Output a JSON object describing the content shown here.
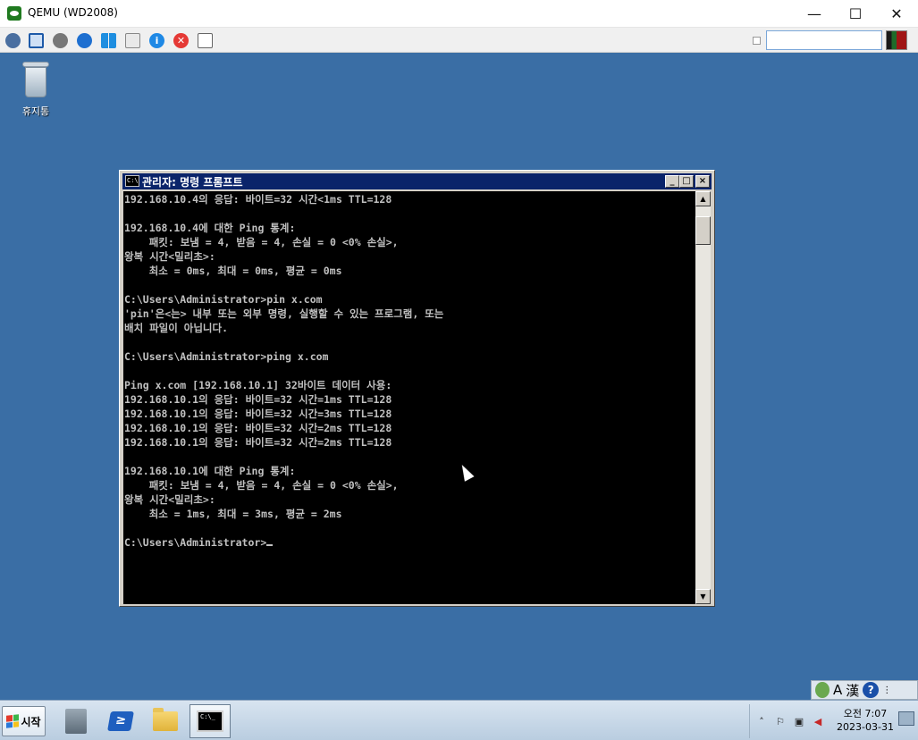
{
  "host": {
    "title": "QEMU (WD2008)",
    "controls": {
      "minimize": "—",
      "maximize": "☐",
      "close": "✕"
    },
    "toolbar_icons": [
      "devices-icon",
      "fullscreen-icon",
      "settings-icon",
      "refresh-icon",
      "windows-icon",
      "usb-icon",
      "info-icon",
      "stop-icon",
      "screenshot-icon"
    ],
    "input_value": ""
  },
  "desktop": {
    "background": "#3a6ea5",
    "recycle_bin_label": "휴지통"
  },
  "cmd": {
    "title": "관리자: 명령 프롬프트",
    "icon_text": "C:\\",
    "buttons": {
      "minimize": "_",
      "maximize": "□",
      "close": "×"
    },
    "lines": [
      "192.168.10.4의 응답: 바이트=32 시간<1ms TTL=128",
      "",
      "192.168.10.4에 대한 Ping 통계:",
      "    패킷: 보냄 = 4, 받음 = 4, 손실 = 0 <0% 손실>,",
      "왕복 시간<밀리초>:",
      "    최소 = 0ms, 최대 = 0ms, 평균 = 0ms",
      "",
      "C:\\Users\\Administrator>pin x.com",
      "'pin'은<는> 내부 또는 외부 명령, 실행할 수 있는 프로그램, 또는",
      "배치 파일이 아닙니다.",
      "",
      "C:\\Users\\Administrator>ping x.com",
      "",
      "Ping x.com [192.168.10.1] 32바이트 데이터 사용:",
      "192.168.10.1의 응답: 바이트=32 시간=1ms TTL=128",
      "192.168.10.1의 응답: 바이트=32 시간=3ms TTL=128",
      "192.168.10.1의 응답: 바이트=32 시간=2ms TTL=128",
      "192.168.10.1의 응답: 바이트=32 시간=2ms TTL=128",
      "",
      "192.168.10.1에 대한 Ping 통계:",
      "    패킷: 보냄 = 4, 받음 = 4, 손실 = 0 <0% 손실>,",
      "왕복 시간<밀리초>:",
      "    최소 = 1ms, 최대 = 3ms, 평균 = 2ms",
      "",
      "C:\\Users\\Administrator>"
    ],
    "scroll": {
      "up": "▲",
      "down": "▼"
    }
  },
  "langbar": {
    "mode_a": "A",
    "mode_han": "漢",
    "help": "?"
  },
  "taskbar": {
    "start_label": "시작",
    "apps": [
      "server-manager-icon",
      "powershell-icon",
      "explorer-icon",
      "cmd-icon"
    ],
    "ps_glyph": "≥",
    "cmd_glyph": "C:\\_",
    "tray_expand": "˄",
    "clock_time": "오전 7:07",
    "clock_date": "2023-03-31"
  }
}
